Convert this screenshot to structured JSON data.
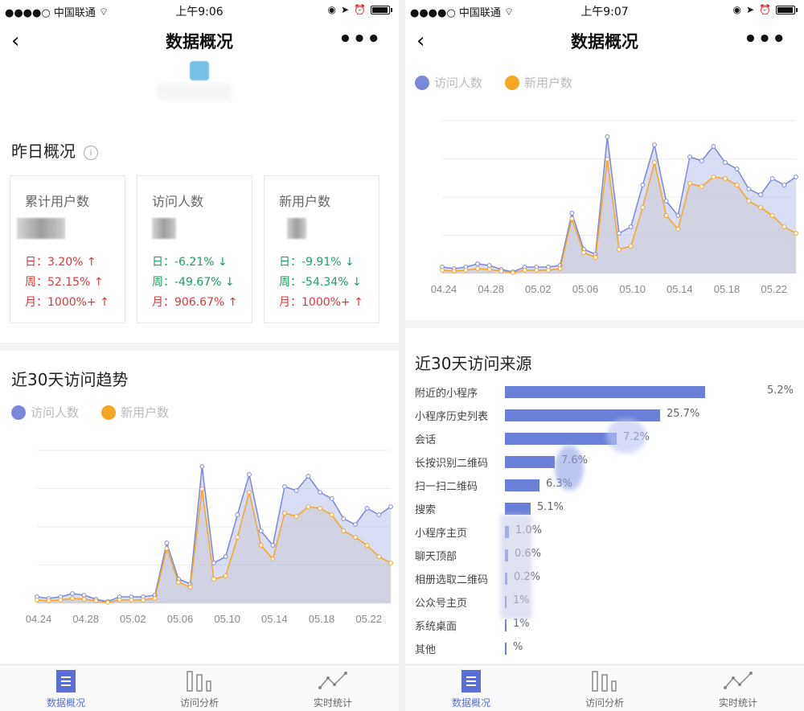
{
  "status": {
    "carrier": "●●●●○ 中国联通",
    "time_left": "上午9:06",
    "time_right": "上午9:07"
  },
  "nav": {
    "title": "数据概况",
    "back": "‹",
    "more": "•••"
  },
  "yesterday": {
    "title": "昨日概况",
    "info_icon": "i",
    "cards": [
      {
        "label": "累计用户数",
        "day": "日：3.20% ↑",
        "week": "周：52.15% ↑",
        "month": "月：1000%+ ↑"
      },
      {
        "label": "访问人数",
        "day": "日：-6.21% ↓",
        "week": "周：-49.67% ↓",
        "month": "月：906.67% ↑"
      },
      {
        "label": "新用户数",
        "day": "日：-9.91% ↓",
        "week": "周：-54.34% ↓",
        "month": "月：1000%+ ↑"
      }
    ]
  },
  "trend": {
    "title": "近30天访问趋势",
    "legend": [
      "访问人数",
      "新用户数"
    ]
  },
  "sources": {
    "title": "近30天访问来源",
    "items": [
      {
        "label": "附近的小程序",
        "value": "5.2%",
        "bar": 0.93
      },
      {
        "label": "小程序历史列表",
        "value": "25.7%",
        "bar": 0.72
      },
      {
        "label": "会话",
        "value": "7.2%",
        "bar": 0.52
      },
      {
        "label": "长按识别二维码",
        "value": "7.6%",
        "bar": 0.23
      },
      {
        "label": "扫一扫二维码",
        "value": "6.3%",
        "bar": 0.16
      },
      {
        "label": "搜索",
        "value": "5.1%",
        "bar": 0.12
      },
      {
        "label": "小程序主页",
        "value": "1.0%",
        "bar": 0.02
      },
      {
        "label": "聊天顶部",
        "value": "0.6%",
        "bar": 0.015
      },
      {
        "label": "相册选取二维码",
        "value": "0.2%",
        "bar": 0.01
      },
      {
        "label": "公众号主页",
        "value": "1%",
        "bar": 0.005
      },
      {
        "label": "系统桌面",
        "value": "1%",
        "bar": 0.005
      },
      {
        "label": "其他",
        "value": "%",
        "bar": 0.003
      }
    ]
  },
  "tabs": [
    "数据概况",
    "访问分析",
    "实时统计"
  ],
  "colors": {
    "visitors": "#7b88d8",
    "new_users": "#f5a623",
    "up": "#d9393c",
    "down": "#19a15f",
    "bar": "#6a7fd8"
  },
  "chart_data": {
    "type": "area",
    "x": [
      "04.24",
      "04.25",
      "04.26",
      "04.27",
      "04.28",
      "04.29",
      "04.30",
      "05.01",
      "05.02",
      "05.03",
      "05.04",
      "05.05",
      "05.06",
      "05.07",
      "05.08",
      "05.09",
      "05.10",
      "05.11",
      "05.12",
      "05.13",
      "05.14",
      "05.15",
      "05.16",
      "05.17",
      "05.18",
      "05.19",
      "05.20",
      "05.21",
      "05.22",
      "05.23",
      "05.24"
    ],
    "tick_labels": [
      "04.24",
      "04.28",
      "05.02",
      "05.06",
      "05.10",
      "05.14",
      "05.18",
      "05.22"
    ],
    "tick_indices": [
      0,
      4,
      8,
      12,
      16,
      20,
      24,
      28
    ],
    "series": [
      {
        "name": "访问人数",
        "values": [
          8,
          6,
          8,
          12,
          10,
          5,
          2,
          8,
          8,
          8,
          10,
          75,
          30,
          24,
          170,
          50,
          58,
          110,
          160,
          90,
          72,
          145,
          140,
          158,
          138,
          130,
          105,
          98,
          118,
          110,
          120
        ]
      },
      {
        "name": "新用户数",
        "values": [
          4,
          3,
          4,
          6,
          5,
          3,
          1,
          4,
          4,
          4,
          6,
          68,
          26,
          20,
          142,
          30,
          34,
          82,
          138,
          72,
          55,
          112,
          108,
          120,
          118,
          110,
          90,
          82,
          72,
          58,
          50
        ]
      }
    ],
    "ylim": [
      0,
      190
    ],
    "grid": true,
    "legend": "top-left"
  }
}
